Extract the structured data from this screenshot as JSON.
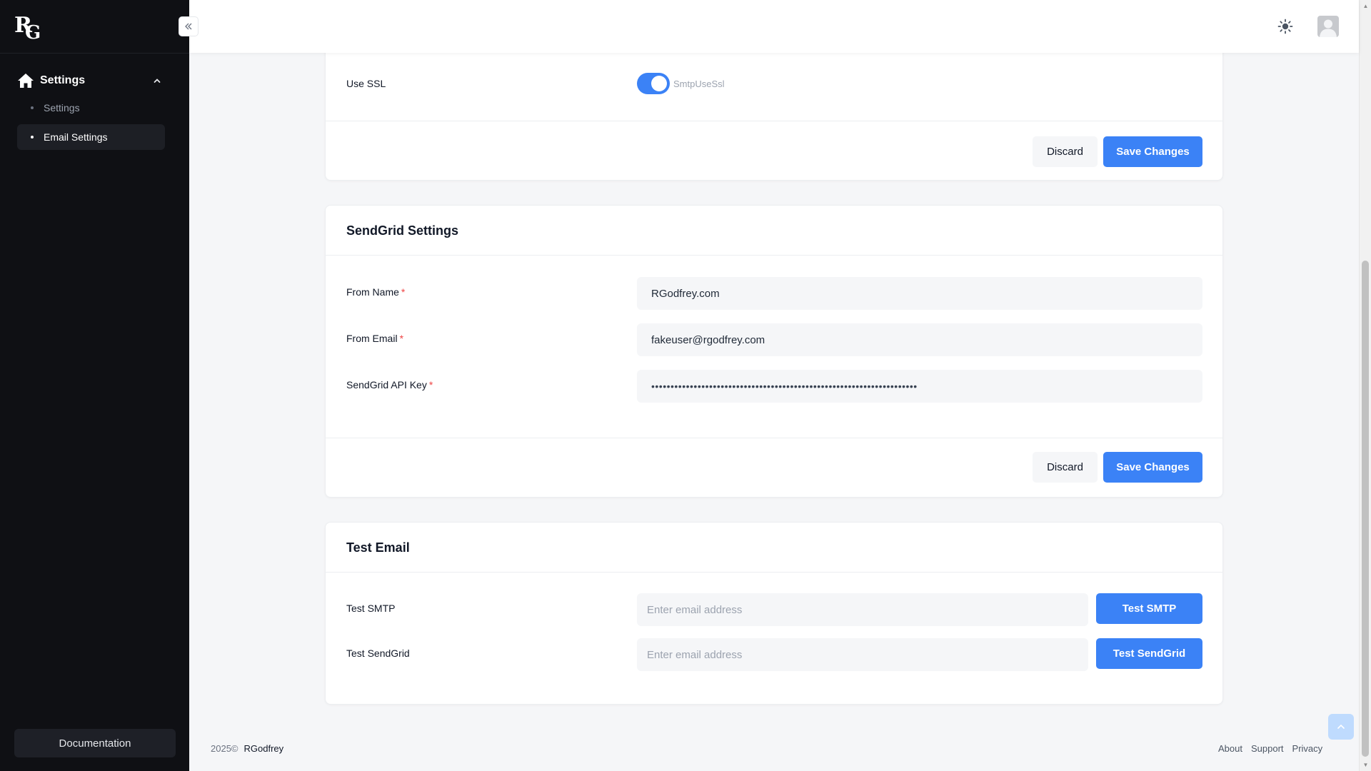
{
  "sidebar": {
    "logo_r": "R",
    "logo_g": "G",
    "group_label": "Settings",
    "items": [
      {
        "label": "Settings"
      },
      {
        "label": "Email Settings"
      }
    ],
    "documentation_label": "Documentation"
  },
  "smtp_section": {
    "use_ssl_label": "Use SSL",
    "use_ssl_value": true,
    "use_ssl_toggle_text": "SmtpUseSsl",
    "discard_label": "Discard",
    "save_label": "Save Changes"
  },
  "sendgrid_section": {
    "title": "SendGrid Settings",
    "from_name_label": "From Name",
    "from_name_value": "RGodfrey.com",
    "from_email_label": "From Email",
    "from_email_value": "fakeuser@rgodfrey.com",
    "api_key_label": "SendGrid API Key",
    "api_key_value": "•••••••••••••••••••••••••••••••••••••••••••••••••••••••••••••••••••••",
    "required_marker": "*",
    "discard_label": "Discard",
    "save_label": "Save Changes"
  },
  "test_section": {
    "title": "Test Email",
    "smtp_label": "Test SMTP",
    "smtp_placeholder": "Enter email address",
    "smtp_button": "Test SMTP",
    "sendgrid_label": "Test SendGrid",
    "sendgrid_placeholder": "Enter email address",
    "sendgrid_button": "Test SendGrid"
  },
  "footer": {
    "year": "2025©",
    "brand": "RGodfrey",
    "links": [
      "About",
      "Support",
      "Privacy"
    ]
  },
  "colors": {
    "primary": "#3b82f6",
    "sidebar_bg": "#0f1014",
    "required": "#ef4444"
  }
}
